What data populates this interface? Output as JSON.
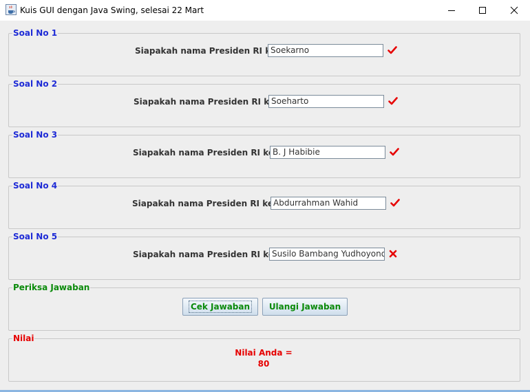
{
  "window": {
    "title": "Kuis GUI dengan Java Swing, selesai 22 Mart"
  },
  "questions": [
    {
      "legend": "Soal No 1",
      "prompt": "Siapakah nama Presiden RI ke I ?",
      "answer": "Soekarno",
      "status": "correct"
    },
    {
      "legend": "Soal No 2",
      "prompt": "Siapakah nama Presiden RI ke II ?",
      "answer": "Soeharto",
      "status": "correct"
    },
    {
      "legend": "Soal No 3",
      "prompt": "Siapakah nama Presiden RI ke III ?",
      "answer": "B. J Habibie",
      "status": "correct"
    },
    {
      "legend": "Soal No 4",
      "prompt": "Siapakah nama Presiden RI ke IV ?",
      "answer": "Abdurrahman Wahid",
      "status": "correct"
    },
    {
      "legend": "Soal No 5",
      "prompt": "Siapakah nama Presiden RI ke V ?",
      "answer": "Susilo Bambang Yudhoyono",
      "status": "wrong"
    }
  ],
  "check": {
    "legend": "Periksa Jawaban",
    "check_label": "Cek Jawaban",
    "reset_label": "Ulangi Jawaban"
  },
  "score": {
    "legend": "Nilai",
    "label": "Nilai Anda =",
    "value": "80"
  },
  "colors": {
    "legend_question": "#1e2bd6",
    "legend_check": "#0a8a0a",
    "legend_score": "#e60000",
    "correct_mark": "#e60000",
    "wrong_mark": "#e60000"
  },
  "icons": {
    "app": "java-cup-icon",
    "minimize": "minimize-icon",
    "maximize": "maximize-icon",
    "close": "close-icon",
    "correct": "checkmark-icon",
    "wrong": "cross-icon"
  }
}
